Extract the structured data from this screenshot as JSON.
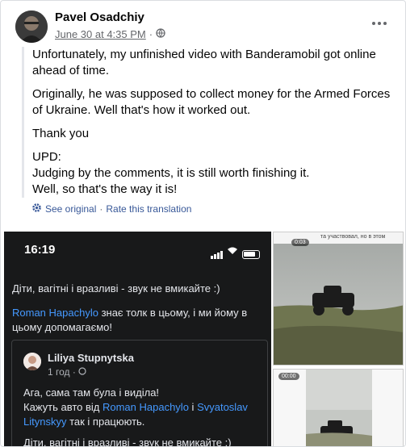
{
  "post": {
    "author": "Pavel Osadchiy",
    "date": "June 30 at 4:35 PM",
    "separator": "·",
    "privacy_icon": "globe-icon",
    "more_icon": "more-horizontal-icon",
    "paragraphs": [
      "Unfortunately, my unfinished video with Banderamobil got online ahead of time.",
      "Originally, he was supposed to collect money for the Armed Forces of Ukraine. Well that's how it worked out.",
      "Thank you"
    ],
    "upd": {
      "title": "UPD:",
      "line1": "Judging by the comments, it is still worth finishing it.",
      "line2": "Well, so that's the way it is!"
    },
    "translation": {
      "icon": "gear-icon",
      "see_original": "See original",
      "dot": "·",
      "rate": "Rate this translation"
    }
  },
  "media": {
    "phone": {
      "time": "16:19",
      "line1": "Діти, вагітні і вразливі - звук не вмикайте :)",
      "line2_link": "Roman Hapachylo",
      "line2_rest": " знає толк в цьому, і ми йому в",
      "line3": "цьому допомагаємо!",
      "comment": {
        "name": "Liliya Stupnytska",
        "time": "1 год ·",
        "text1": "Ага, сама там була і виділа!",
        "text2_pre": "Кажуть авто від ",
        "text2_link1": "Roman Hapachylo",
        "text2_mid": " і ",
        "text2_link2": "Svyatoslav",
        "text3_link": "Litynskyy",
        "text3_rest": " так і працюють.",
        "text4": "Діти, вагітні і вразливі - звук не вмикайте :)"
      }
    },
    "video1": {
      "caption": "та участвовал, но в этом",
      "badge": "0:03"
    },
    "video2": {
      "badge": "00:00"
    }
  },
  "colors": {
    "link": "#385898",
    "phone_link": "#4599ff",
    "muted": "#65676b"
  }
}
